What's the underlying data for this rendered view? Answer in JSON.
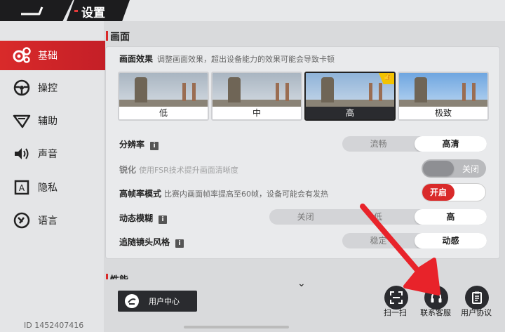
{
  "header": {
    "title": "设置"
  },
  "sidebar": {
    "items": [
      {
        "label": "基础",
        "icon": "gears-icon",
        "active": true
      },
      {
        "label": "操控",
        "icon": "steering-wheel-icon"
      },
      {
        "label": "辅助",
        "icon": "assist-icon"
      },
      {
        "label": "声音",
        "icon": "speaker-icon"
      },
      {
        "label": "隐私",
        "icon": "privacy-icon"
      },
      {
        "label": "语言",
        "icon": "language-icon"
      }
    ],
    "user_id": "ID 1452407416"
  },
  "graphics": {
    "section_title": "画面",
    "effect_label": "画面效果",
    "effect_hint": "调整画面效果，超出设备能力的效果可能会导致卡顿",
    "quality_options": [
      "低",
      "中",
      "高",
      "极致"
    ],
    "quality_selected": "高",
    "resolution": {
      "label": "分辨率",
      "options": [
        "流畅",
        "高清"
      ],
      "selected": "高清"
    },
    "sharpen": {
      "label": "锐化",
      "hint": "使用FSR技术提升画面清晰度",
      "state": "关闭"
    },
    "high_fps": {
      "label": "高帧率模式",
      "hint": "比赛内画面帧率提高至60帧，设备可能会有发热",
      "state": "开启"
    },
    "motion_blur": {
      "label": "动态模糊",
      "options": [
        "关闭",
        "低",
        "高"
      ],
      "selected": "高"
    },
    "camera_style": {
      "label": "追随镜头风格",
      "options": [
        "稳定",
        "动感"
      ],
      "selected": "动感"
    }
  },
  "performance": {
    "section_title": "性能"
  },
  "footer": {
    "user_center": "用户中心",
    "scan": "扫一扫",
    "support": "联系客服",
    "agreement": "用户协议"
  },
  "colors": {
    "accent": "#d92a2a",
    "dark": "#2a2b2f",
    "arrow": "#e8232a"
  }
}
